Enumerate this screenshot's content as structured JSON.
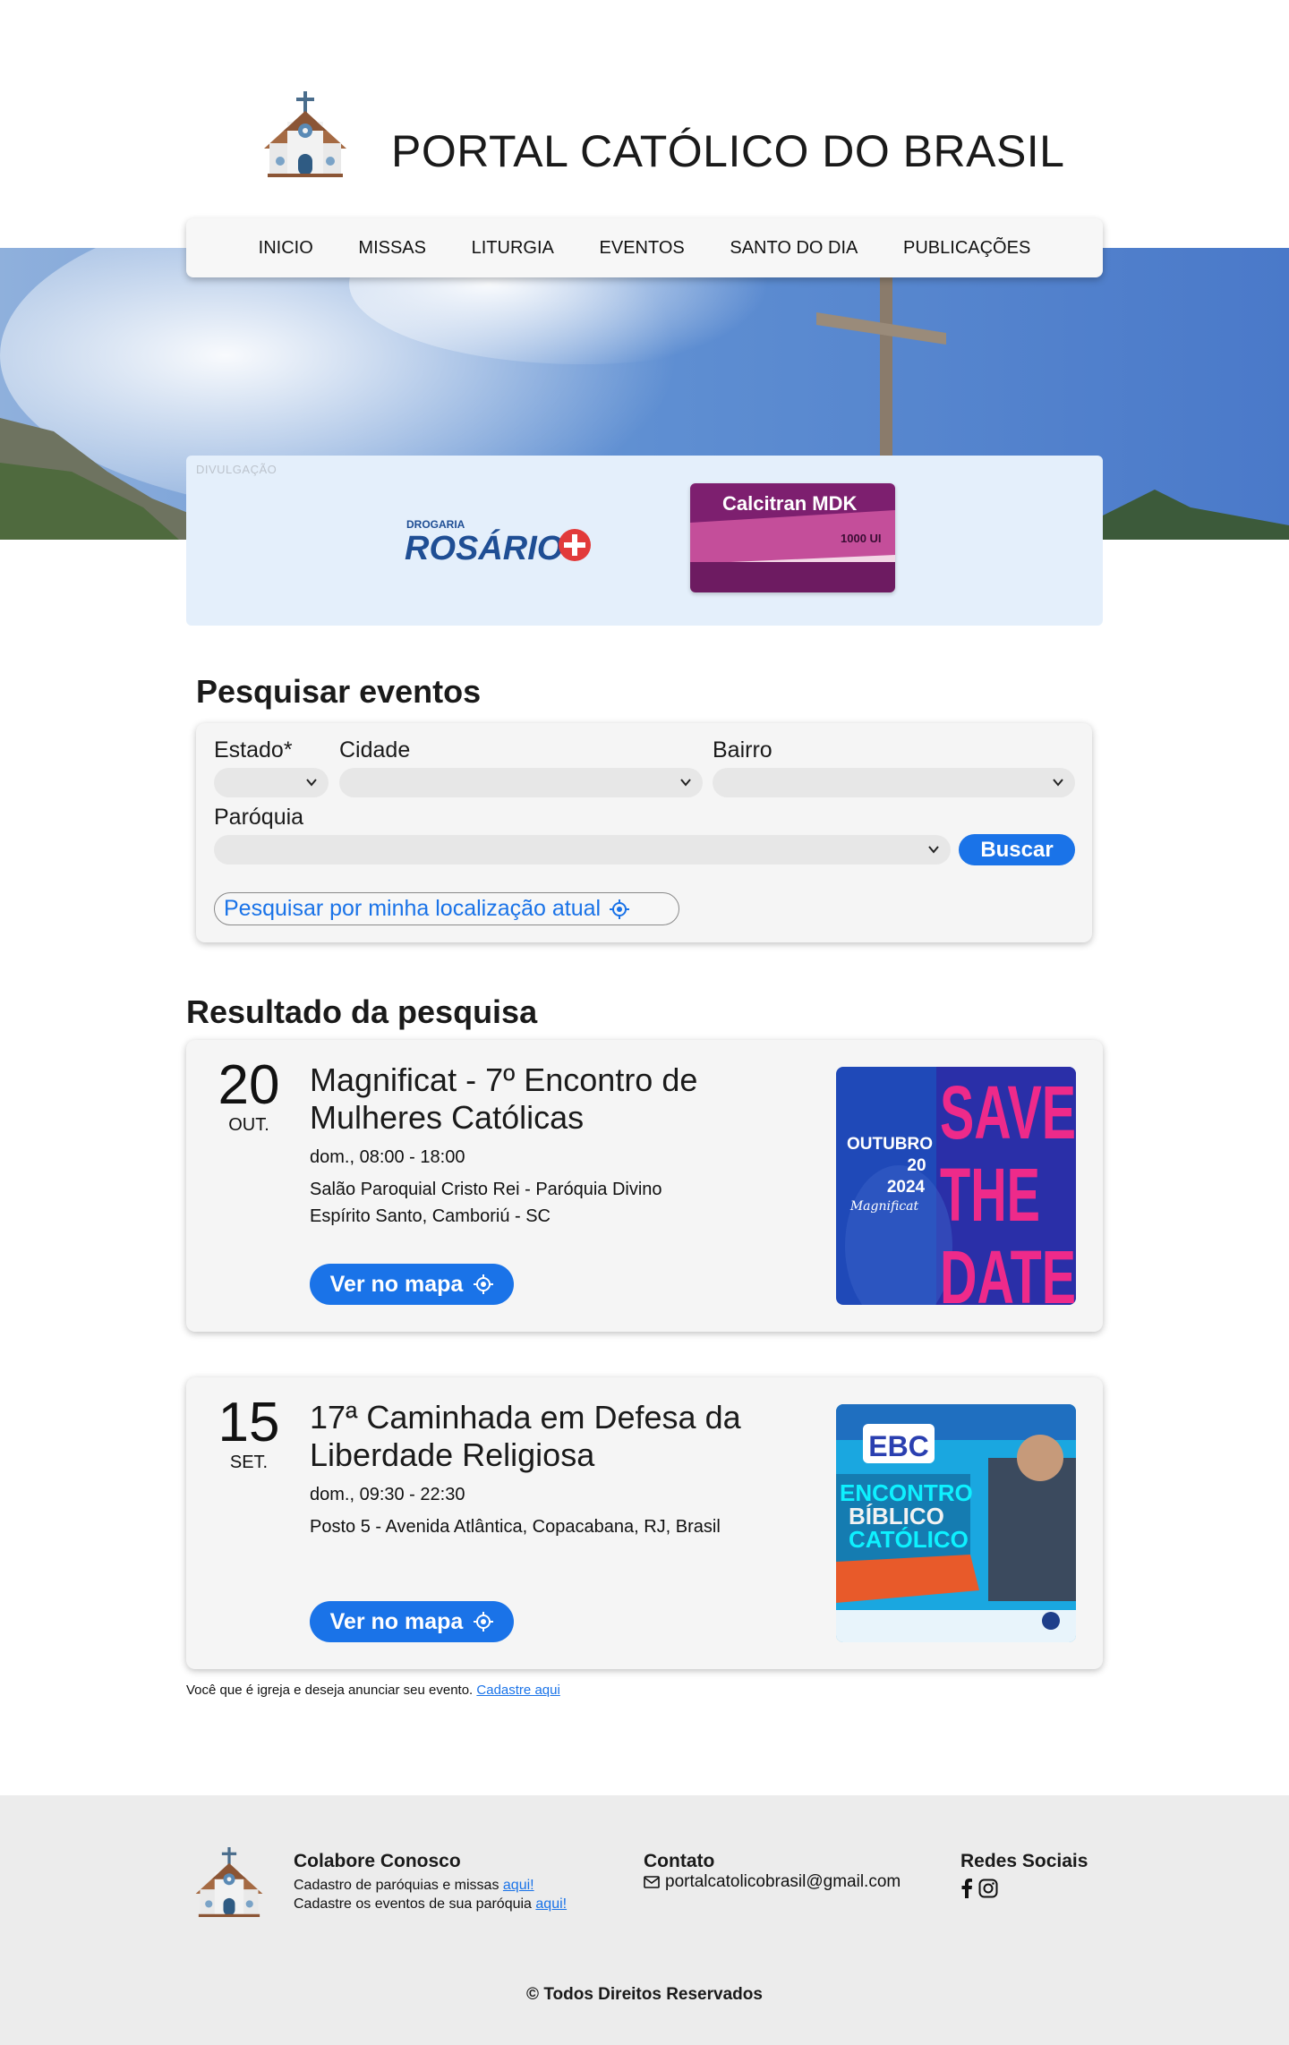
{
  "header": {
    "site_title": "PORTAL CATÓLICO DO BRASIL"
  },
  "nav": {
    "items": [
      "INICIO",
      "MISSAS",
      "LITURGIA",
      "EVENTOS",
      "SANTO DO DIA",
      "PUBLICAÇÕES"
    ]
  },
  "ad": {
    "label": "DIVULGAÇÃO",
    "rosario_small": "DROGARIA",
    "rosario_brand": "ROSÁRIO",
    "calcitran_brand": "Calcitran MDK",
    "calcitran_dose": "1000 UI"
  },
  "search": {
    "title": "Pesquisar eventos",
    "estado_label": "Estado*",
    "cidade_label": "Cidade",
    "bairro_label": "Bairro",
    "paroquia_label": "Paróquia",
    "buscar_label": "Buscar",
    "location_label": "Pesquisar por minha localização atual"
  },
  "results": {
    "title": "Resultado da pesquisa",
    "map_button_label": "Ver no mapa",
    "events": [
      {
        "day": "20",
        "month": "OUT.",
        "title": "Magnificat - 7º Encontro de Mulheres Católicas",
        "time": "dom., 08:00 - 18:00",
        "place": "Salão Paroquial Cristo Rei - Paróquia Divino Espírito Santo, Camboriú - SC",
        "poster_month": "OUTUBRO",
        "poster_day": "20",
        "poster_year": "2024",
        "poster_name": "Magnificat",
        "poster_slogan_1": "SAVE",
        "poster_slogan_2": "THE",
        "poster_slogan_3": "DATE"
      },
      {
        "day": "15",
        "month": "SET.",
        "title": "17ª Caminhada em Defesa da Liberdade Religiosa",
        "time": "dom., 09:30 - 22:30",
        "place": "Posto 5 - Avenida Atlântica, Copacabana, RJ, Brasil",
        "poster_brand": "EBC",
        "poster_line_1": "ENCONTRO",
        "poster_line_2": "BÍBLICO",
        "poster_line_3": "CATÓLICO"
      }
    ]
  },
  "cta": {
    "text": "Você que é igreja e deseja anunciar seu evento. ",
    "link": "Cadastre aqui"
  },
  "footer": {
    "colabore_title": "Colabore Conosco",
    "colabore_line1": "Cadastro de paróquias e missas ",
    "colabore_line2": "Cadastre os eventos de sua paróquia ",
    "link_text": "aqui!",
    "contato_title": "Contato",
    "email": "portalcatolicobrasil@gmail.com",
    "redes_title": "Redes Sociais",
    "copyright": "© Todos Direitos Reservados"
  },
  "colors": {
    "accent": "#1a73e8",
    "card_bg": "#f5f5f5",
    "ad_bg": "#e4effb",
    "footer_bg": "#ececec"
  }
}
